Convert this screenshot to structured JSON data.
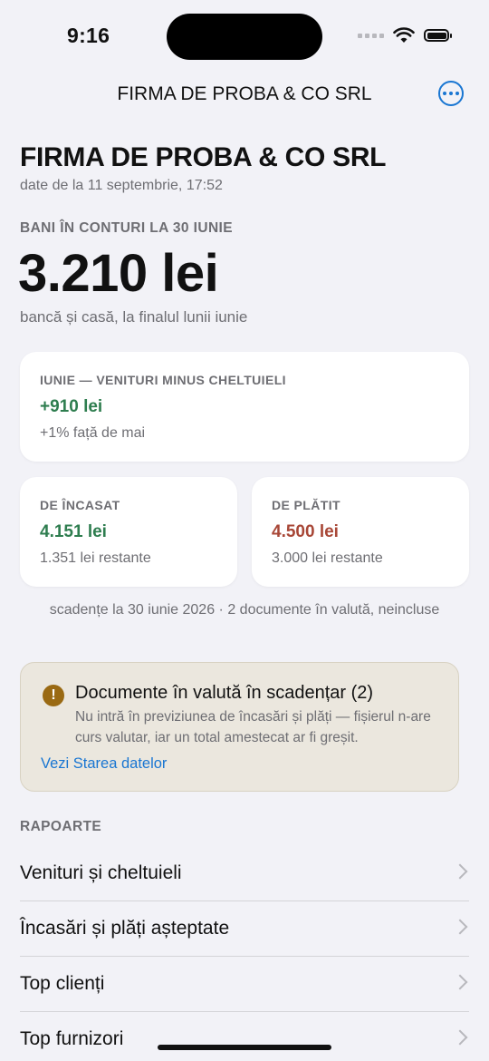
{
  "status_bar": {
    "time": "9:16"
  },
  "nav": {
    "title": "FIRMA DE PROBA & CO SRL"
  },
  "header": {
    "company": "FIRMA DE PROBA & CO SRL",
    "date_line": "date de la 11 septembrie, 17:52"
  },
  "balance": {
    "caption": "BANI ÎN CONTURI LA 30 IUNIE",
    "amount": "3.210 lei",
    "subtitle": "bancă și casă, la finalul lunii iunie"
  },
  "month_card": {
    "caption": "IUNIE — VENITURI MINUS CHELTUIELI",
    "value": "+910 lei",
    "comparison": "+1% față de mai"
  },
  "receivable_card": {
    "caption": "DE ÎNCASAT",
    "value": "4.151 lei",
    "overdue": "1.351 lei restante"
  },
  "payable_card": {
    "caption": "DE PLĂTIT",
    "value": "4.500 lei",
    "overdue": "3.000 lei restante"
  },
  "note": "scadențe la 30 iunie 2026 · 2 documente în valută, neincluse",
  "warning": {
    "icon": "!",
    "title": "Documente în valută în scadențar (2)",
    "text": "Nu intră în previziunea de încasări și plăți — fișierul n-are curs valutar, iar un total amestecat ar fi greșit.",
    "link": "Vezi Starea datelor"
  },
  "reports": {
    "caption": "RAPOARTE",
    "items": [
      {
        "label": "Venituri și cheltuieli"
      },
      {
        "label": "Încasări și plăți așteptate"
      },
      {
        "label": "Top clienți"
      },
      {
        "label": "Top furnizori"
      }
    ]
  },
  "colors": {
    "accent": "#1976d2",
    "positive": "#2e7d4f",
    "negative": "#a84737",
    "warning_icon": "#9a6a13"
  }
}
